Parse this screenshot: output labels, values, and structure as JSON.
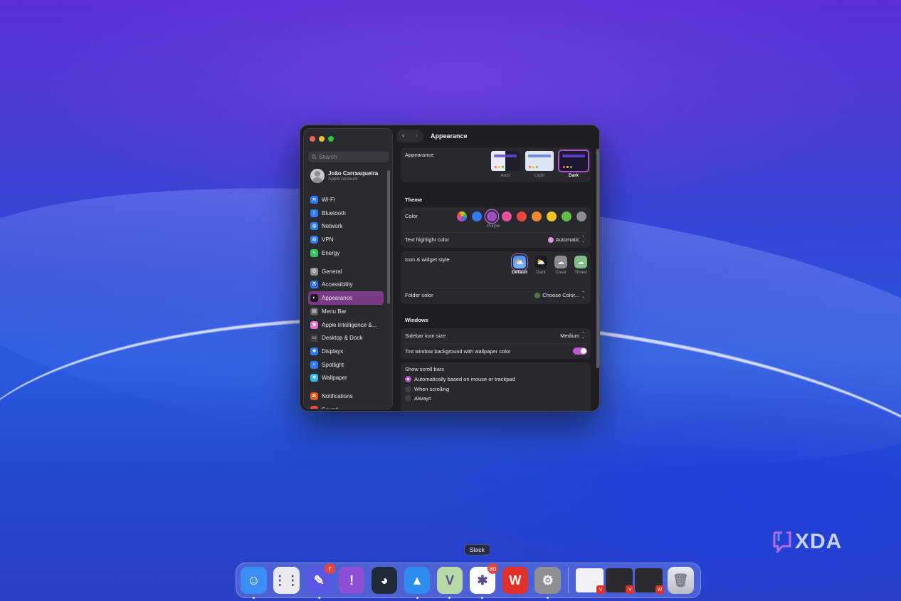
{
  "window": {
    "title": "Appearance",
    "sidebar": {
      "search_placeholder": "Search",
      "account": {
        "name": "João Carrasqueira",
        "subtitle": "Apple Account"
      },
      "groups": [
        [
          {
            "label": "Wi-Fi",
            "icon": "wifi-icon",
            "color": "#2e7cf6",
            "glyph": "≋"
          },
          {
            "label": "Bluetooth",
            "icon": "bluetooth-icon",
            "color": "#2e7cf6",
            "glyph": "ᛒ"
          },
          {
            "label": "Network",
            "icon": "network-icon",
            "color": "#2e7cf6",
            "glyph": "◍"
          },
          {
            "label": "VPN",
            "icon": "vpn-icon",
            "color": "#2e7cf6",
            "glyph": "◍"
          },
          {
            "label": "Energy",
            "icon": "energy-icon",
            "color": "#34c759",
            "glyph": "ϟ"
          }
        ],
        [
          {
            "label": "General",
            "icon": "gear-icon",
            "color": "#8e8e93",
            "glyph": "⚙"
          },
          {
            "label": "Accessibility",
            "icon": "accessibility-icon",
            "color": "#2e7cf6",
            "glyph": "♿"
          },
          {
            "label": "Appearance",
            "icon": "appearance-icon",
            "color": "#1c1c1e",
            "glyph": "◐",
            "selected": true
          },
          {
            "label": "Menu Bar",
            "icon": "menu-bar-icon",
            "color": "#5e5e66",
            "glyph": "▤"
          },
          {
            "label": "Apple Intelligence &...",
            "icon": "apple-intelligence-icon",
            "color": "#e46fd2",
            "glyph": "✺"
          },
          {
            "label": "Desktop & Dock",
            "icon": "desktop-dock-icon",
            "color": "#3a3a40",
            "glyph": "▭"
          },
          {
            "label": "Displays",
            "icon": "displays-icon",
            "color": "#2e7cf6",
            "glyph": "✹"
          },
          {
            "label": "Spotlight",
            "icon": "spotlight-icon",
            "color": "#2e7cf6",
            "glyph": "⌕"
          },
          {
            "label": "Wallpaper",
            "icon": "wallpaper-icon",
            "color": "#2fb7e8",
            "glyph": "❋"
          }
        ],
        [
          {
            "label": "Notifications",
            "icon": "notifications-icon",
            "color": "#f2453d",
            "glyph": "🔔"
          },
          {
            "label": "Sound",
            "icon": "sound-icon",
            "color": "#f2453d",
            "glyph": "♪"
          }
        ]
      ]
    },
    "appearance": {
      "label": "Appearance",
      "options": [
        {
          "caption": "Auto",
          "selected": false
        },
        {
          "caption": "Light",
          "selected": false
        },
        {
          "caption": "Dark",
          "selected": true
        }
      ]
    },
    "theme": {
      "heading": "Theme",
      "color_label": "Color",
      "selected_caption": "Purple",
      "swatches": [
        "multicolor",
        "#2f7cf6",
        "#9b4fc2",
        "#e8519a",
        "#e8463f",
        "#f18a2c",
        "#f5c424",
        "#5fbe44",
        "#8e8e93"
      ],
      "selected_index": 2,
      "highlight_label": "Text highlight color",
      "highlight_value": "Automatic",
      "highlight_color": "#d99bd8",
      "widget_label": "Icon & widget style",
      "widget_options": [
        {
          "caption": "Default",
          "selected": true
        },
        {
          "caption": "Dark",
          "selected": false
        },
        {
          "caption": "Clear",
          "selected": false
        },
        {
          "caption": "Tinted",
          "selected": false
        }
      ],
      "folder_label": "Folder color",
      "folder_value": "Choose Color...",
      "folder_color": "#4e7a3f"
    },
    "windows": {
      "heading": "Windows",
      "sidebar_size_label": "Sidebar icon size",
      "sidebar_size_value": "Medium",
      "tint_label": "Tint window background with wallpaper color",
      "tint_on": true,
      "scroll_label": "Show scroll bars",
      "scroll_options": [
        {
          "label": "Automatically based on mouse or trackpad",
          "selected": true
        },
        {
          "label": "When scrolling",
          "selected": false
        },
        {
          "label": "Always",
          "selected": false
        }
      ]
    }
  },
  "dock": {
    "tooltip": "Slack",
    "apps": [
      {
        "name": "finder-icon",
        "bg": "#3a8ef5",
        "glyph": "☺",
        "running": true
      },
      {
        "name": "launchpad-icon",
        "bg": "#e9e9ee",
        "glyph": "⋮⋮",
        "running": false
      },
      {
        "name": "chat-app-icon",
        "bg": "#5a56e6",
        "glyph": "✎",
        "badge": "7",
        "running": true
      },
      {
        "name": "feedback-icon",
        "bg": "#8e4fd6",
        "glyph": "!",
        "running": false
      },
      {
        "name": "davinci-resolve-icon",
        "bg": "#1d2a38",
        "glyph": "◕",
        "running": false
      },
      {
        "name": "safari-like-icon",
        "bg": "#2e8bf0",
        "glyph": "▲",
        "running": true
      },
      {
        "name": "vivaldi-icon",
        "bg": "#b8d8a8",
        "glyph": "V",
        "running": true
      },
      {
        "name": "slack-icon",
        "bg": "#ffffff",
        "glyph": "✱",
        "badge": "80",
        "running": true
      },
      {
        "name": "wps-office-icon",
        "bg": "#e2312a",
        "glyph": "W",
        "running": false
      },
      {
        "name": "system-settings-icon",
        "bg": "#8e8e93",
        "glyph": "⚙",
        "running": true
      }
    ],
    "minimized": [
      {
        "name": "minimized-vivaldi-window",
        "bg": "#f2f2f4",
        "badge": "V"
      },
      {
        "name": "minimized-vivaldi-window-2",
        "bg": "#2a2a30",
        "badge": "V"
      },
      {
        "name": "minimized-wps-window",
        "bg": "#2a2a30",
        "badge": "W"
      }
    ],
    "trash": "trash-icon"
  },
  "watermark": "XDA"
}
